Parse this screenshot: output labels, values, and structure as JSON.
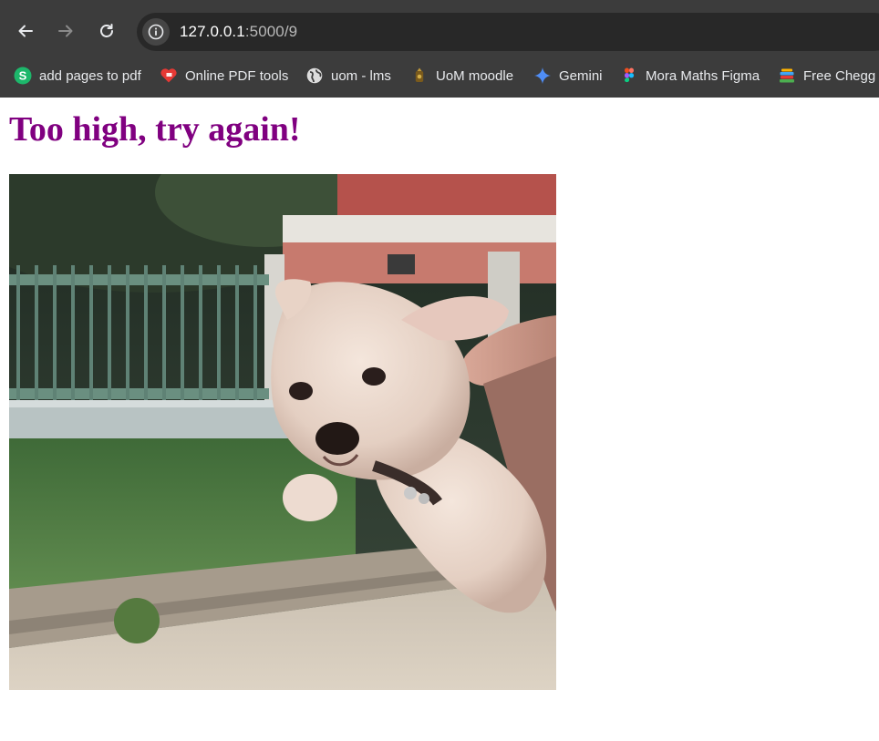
{
  "browser": {
    "url_host": "127.0.0.1",
    "url_path": ":5000/9",
    "nav": {
      "back": "back-arrow-icon",
      "forward": "forward-arrow-icon",
      "reload": "reload-icon"
    },
    "bookmarks": [
      {
        "label": "add pages to pdf",
        "icon": "s-logo-icon"
      },
      {
        "label": "Online PDF tools",
        "icon": "heart-pdf-icon"
      },
      {
        "label": "uom - lms",
        "icon": "globe-icon"
      },
      {
        "label": "UoM moodle",
        "icon": "moodle-icon"
      },
      {
        "label": "Gemini",
        "icon": "gemini-icon"
      },
      {
        "label": "Mora Maths Figma",
        "icon": "figma-icon"
      },
      {
        "label": "Free Chegg a",
        "icon": "books-icon"
      }
    ]
  },
  "page": {
    "heading": "Too high, try again!",
    "heading_color": "#800080",
    "image": "puppy-photo"
  }
}
